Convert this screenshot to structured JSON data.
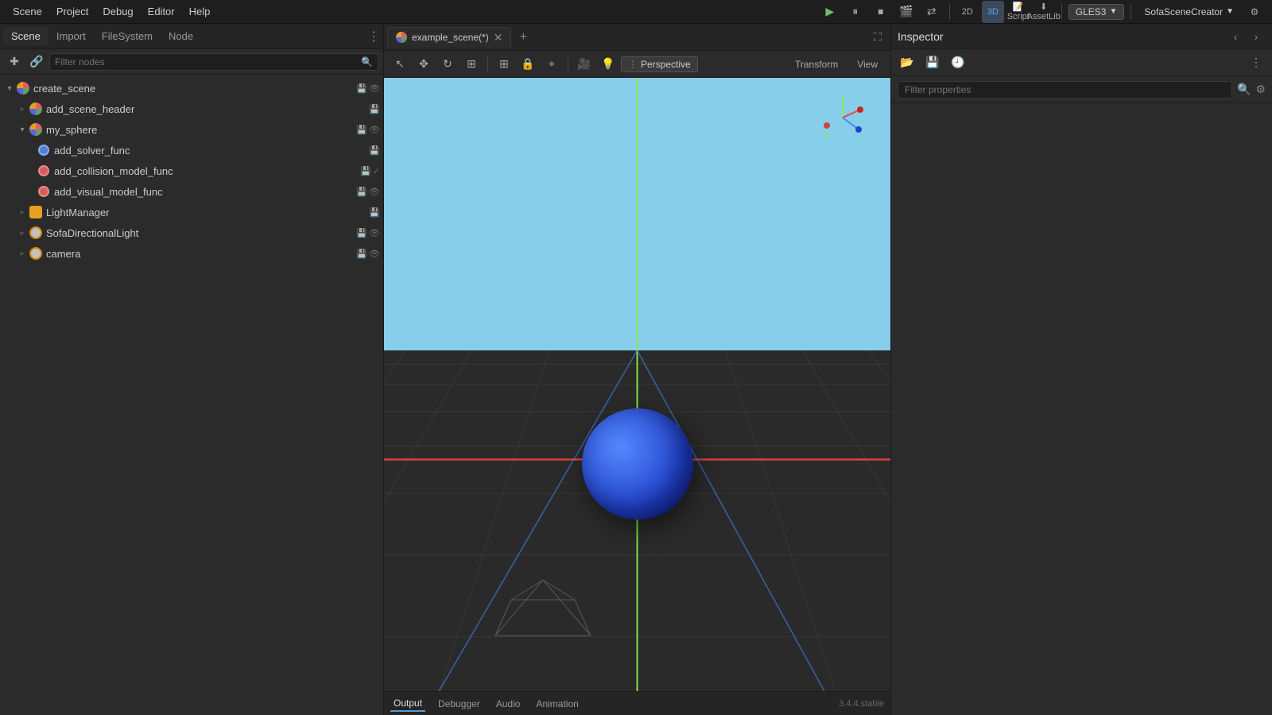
{
  "menubar": {
    "items": [
      "Scene",
      "Project",
      "Debug",
      "Editor",
      "Help"
    ]
  },
  "toolbar": {
    "play_label": "▶",
    "pause_label": "⏸",
    "stop_label": "⏹",
    "movie_label": "🎬",
    "remote_label": "📡",
    "mode_2d": "2D",
    "mode_3d": "3D",
    "script_label": "Script",
    "assetlib_label": "AssetLib",
    "gles": "GLES3",
    "creator": "SofaSceneCreator"
  },
  "left_panel": {
    "tabs": [
      "Scene",
      "Import",
      "FileSystem",
      "Node"
    ],
    "more_btn": "⋮",
    "filter_placeholder": "Filter nodes",
    "tree": [
      {
        "id": "create_scene",
        "label": "create_scene",
        "level": 0,
        "expanded": true,
        "icon_type": "root",
        "has_actions": true,
        "actions": [
          "save",
          "eye"
        ]
      },
      {
        "id": "add_scene_header",
        "label": "add_scene_header",
        "level": 1,
        "expanded": false,
        "icon_type": "sphere",
        "has_actions": true,
        "actions": [
          "save"
        ]
      },
      {
        "id": "my_sphere",
        "label": "my_sphere",
        "level": 1,
        "expanded": true,
        "icon_type": "sphere",
        "has_actions": true,
        "actions": [
          "save",
          "eye"
        ]
      },
      {
        "id": "add_solver_func",
        "label": "add_solver_func",
        "level": 2,
        "expanded": false,
        "icon_type": "component",
        "has_actions": true,
        "actions": [
          "save"
        ]
      },
      {
        "id": "add_collision_model_func",
        "label": "add_collision_model_func",
        "level": 2,
        "expanded": false,
        "icon_type": "collision",
        "has_actions": true,
        "actions": [
          "save",
          "check"
        ]
      },
      {
        "id": "add_visual_model_func",
        "label": "add_visual_model_func",
        "level": 2,
        "expanded": false,
        "icon_type": "collision",
        "has_actions": true,
        "actions": [
          "save",
          "eye"
        ]
      },
      {
        "id": "LightManager",
        "label": "LightManager",
        "level": 1,
        "expanded": false,
        "icon_type": "light",
        "has_actions": true,
        "actions": [
          "save"
        ]
      },
      {
        "id": "SofaDirectionalLight",
        "label": "SofaDirectionalLight",
        "level": 1,
        "expanded": false,
        "icon_type": "directional",
        "has_actions": true,
        "actions": [
          "save",
          "eye"
        ]
      },
      {
        "id": "camera",
        "label": "camera",
        "level": 1,
        "expanded": false,
        "icon_type": "camera",
        "has_actions": true,
        "actions": [
          "save",
          "eye"
        ]
      }
    ]
  },
  "viewport": {
    "tab_name": "example_scene(*)",
    "perspective_label": "Perspective",
    "transform_btn": "Transform",
    "view_btn": "View",
    "bottom_tabs": [
      "Output",
      "Debugger",
      "Audio",
      "Animation"
    ],
    "version": "3.4.4.stable"
  },
  "inspector": {
    "title": "Inspector",
    "filter_placeholder": "Filter properties"
  }
}
